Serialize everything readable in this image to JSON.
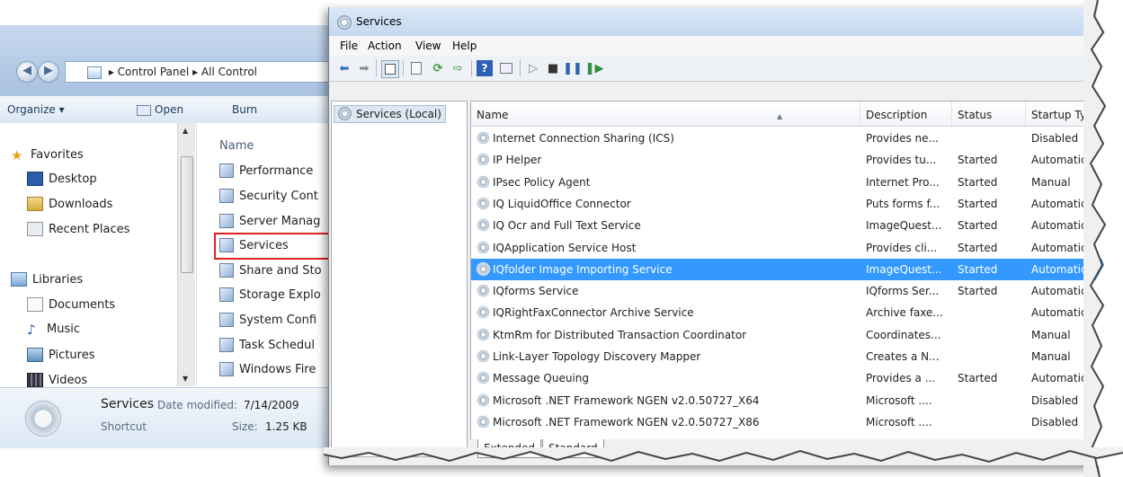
{
  "explorer": {
    "breadcrumb": [
      "Control Panel",
      "All Control"
    ],
    "toolbar": {
      "organize": "Organize ▾",
      "open": "Open",
      "burn": "Burn"
    },
    "nav": {
      "favorites_header": "Favorites",
      "favorites": [
        "Desktop",
        "Downloads",
        "Recent Places"
      ],
      "libraries_header": "Libraries",
      "libraries": [
        "Documents",
        "Music",
        "Pictures",
        "Videos"
      ]
    },
    "files": {
      "column_header": "Name",
      "items": [
        "Performance",
        "Security Cont",
        "Server Manag",
        "Services",
        "Share and Sto",
        "Storage Explo",
        "System Confi",
        "Task Schedul",
        "Windows Fire"
      ]
    },
    "details": {
      "name": "Services",
      "type": "Shortcut",
      "date_label": "Date modified:",
      "date_value": "7/14/2009",
      "size_label": "Size:",
      "size_value": "1.25 KB"
    }
  },
  "services": {
    "title": "Services",
    "menu": [
      "File",
      "Action",
      "View",
      "Help"
    ],
    "tree_item": "Services (Local)",
    "columns": [
      "Name",
      "Description",
      "Status",
      "Startup Ty"
    ],
    "rows": [
      {
        "name": "Internet Connection Sharing (ICS)",
        "description": "Provides ne...",
        "status": "",
        "startup": "Disabled"
      },
      {
        "name": "IP Helper",
        "description": "Provides tu...",
        "status": "Started",
        "startup": "Automatic"
      },
      {
        "name": "IPsec Policy Agent",
        "description": "Internet Pro...",
        "status": "Started",
        "startup": "Manual"
      },
      {
        "name": "IQ LiquidOffice Connector",
        "description": "Puts forms f...",
        "status": "Started",
        "startup": "Automatic"
      },
      {
        "name": "IQ Ocr and Full Text Service",
        "description": "ImageQuest...",
        "status": "Started",
        "startup": "Automatic"
      },
      {
        "name": "IQApplication Service Host",
        "description": "Provides cli...",
        "status": "Started",
        "startup": "Automatic"
      },
      {
        "name": "IQfolder Image Importing Service",
        "description": "ImageQuest...",
        "status": "Started",
        "startup": "Automatic"
      },
      {
        "name": "IQforms Service",
        "description": "IQforms Ser...",
        "status": "Started",
        "startup": "Automatic"
      },
      {
        "name": "IQRightFaxConnector Archive Service",
        "description": "Archive faxe...",
        "status": "",
        "startup": "Automatic"
      },
      {
        "name": "KtmRm for Distributed Transaction Coordinator",
        "description": "Coordinates...",
        "status": "",
        "startup": "Manual"
      },
      {
        "name": "Link-Layer Topology Discovery Mapper",
        "description": "Creates a N...",
        "status": "",
        "startup": "Manual"
      },
      {
        "name": "Message Queuing",
        "description": "Provides a ...",
        "status": "Started",
        "startup": "Automatic"
      },
      {
        "name": "Microsoft .NET Framework NGEN v2.0.50727_X64",
        "description": "Microsoft ....",
        "status": "",
        "startup": "Disabled"
      },
      {
        "name": "Microsoft .NET Framework NGEN v2.0.50727_X86",
        "description": "Microsoft ....",
        "status": "",
        "startup": "Disabled"
      }
    ],
    "selected_row": "IQfolder Image Importing Service",
    "tabs": [
      "Extended",
      "Standard"
    ]
  },
  "colors": {
    "selection": "#3399ff",
    "highlight_box": "#e02020",
    "title_bar": "#c4d8ef"
  },
  "icons": [
    "back-icon",
    "forward-icon",
    "gear-icon",
    "star-icon",
    "folder-icon",
    "play-icon",
    "stop-icon",
    "pause-icon",
    "resume-icon",
    "help-icon",
    "refresh-icon",
    "export-icon"
  ]
}
